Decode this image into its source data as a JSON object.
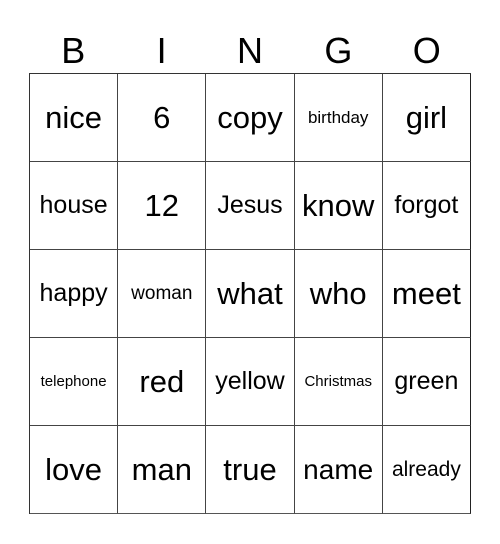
{
  "header": {
    "letters": [
      "B",
      "I",
      "N",
      "G",
      "O"
    ]
  },
  "card": {
    "rows": [
      [
        "nice",
        "6",
        "copy",
        "birthday",
        "girl"
      ],
      [
        "house",
        "12",
        "Jesus",
        "know",
        "forgot"
      ],
      [
        "happy",
        "woman",
        "what",
        "who",
        "meet"
      ],
      [
        "telephone",
        "red",
        "yellow",
        "Christmas",
        "green"
      ],
      [
        "love",
        "man",
        "true",
        "name",
        "already"
      ]
    ]
  }
}
